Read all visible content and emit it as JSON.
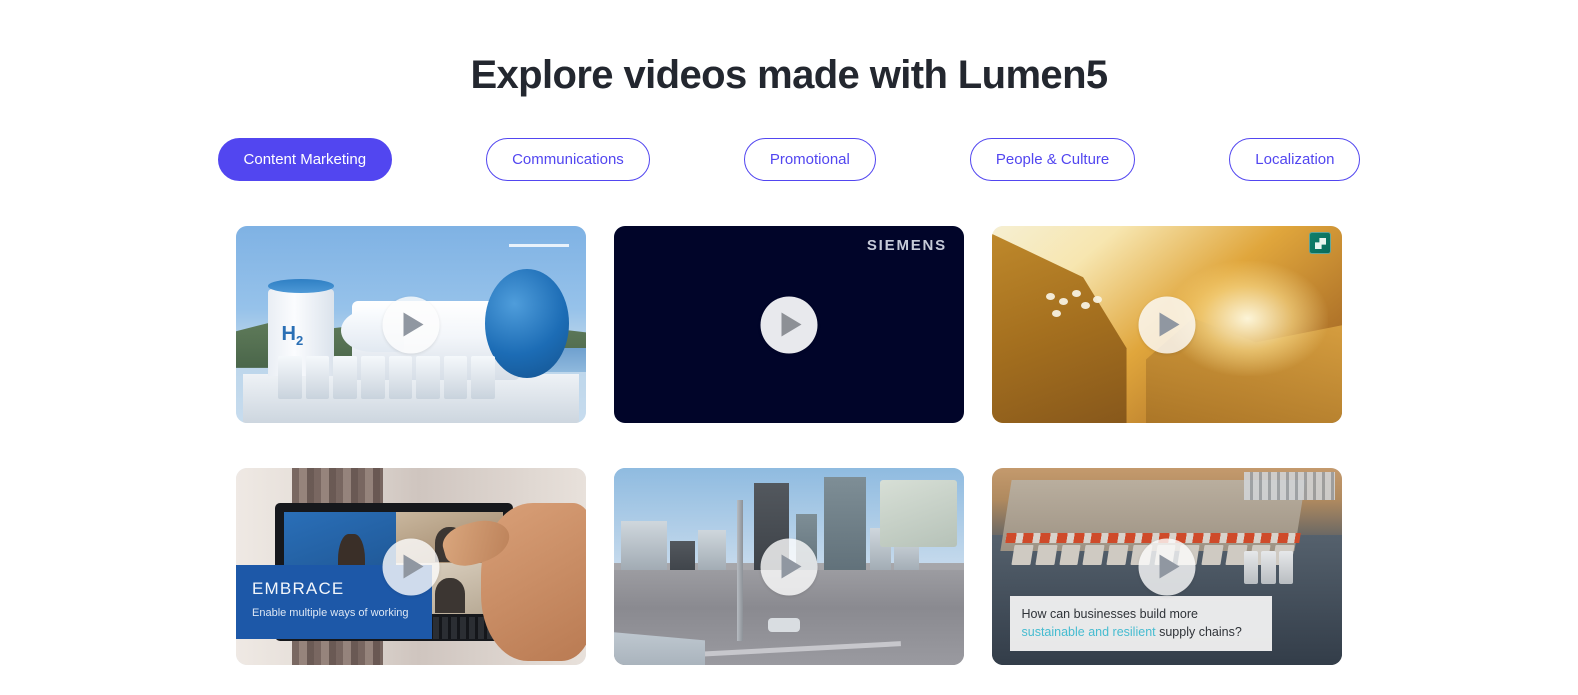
{
  "page": {
    "title": "Explore videos made with Lumen5",
    "background_color": "#ffffff",
    "accent_color": "#5246f0"
  },
  "filters": {
    "items": [
      {
        "label": "Content Marketing",
        "active": true
      },
      {
        "label": "Communications",
        "active": false
      },
      {
        "label": "Promotional",
        "active": false
      },
      {
        "label": "People & Culture",
        "active": false
      },
      {
        "label": "Localization",
        "active": false
      }
    ]
  },
  "videos": [
    {
      "id": "hydrogen-plant",
      "scene": "hydrogen storage plant with H2 tank, white cylinder and blue sphere under blue sky",
      "overlay_label": "H",
      "overlay_sub": "2",
      "play_icon": "play-icon",
      "play_style": "translucent"
    },
    {
      "id": "siemens",
      "scene": "dark navy title card",
      "brand": "SIEMENS",
      "background_color": "#010529",
      "play_icon": "play-icon",
      "play_style": "solid"
    },
    {
      "id": "golden-hillside",
      "scene": "sunlit golden hillside with sheep at sunset",
      "logo_badge": "teal-square-logo",
      "play_icon": "play-icon",
      "play_style": "translucent"
    },
    {
      "id": "embrace-video-call",
      "scene": "laptop video conference call with hand gesturing",
      "banner_title": "EMBRACE",
      "banner_subtitle": "Enable multiple ways of working",
      "banner_color": "#1d58a8",
      "play_icon": "play-icon",
      "play_style": "translucent"
    },
    {
      "id": "city-street",
      "scene": "empty city boulevard with high rise towers and clear sky",
      "play_icon": "play-icon",
      "play_style": "translucent"
    },
    {
      "id": "supply-chain-warehouse",
      "scene": "aerial view of distribution warehouse with trucks at loading docks",
      "caption_part1": "How can businesses build more ",
      "caption_highlight": "sustainable and resilient",
      "caption_part2": " supply chains?",
      "caption_highlight_color": "#46bcd0",
      "play_icon": "play-icon",
      "play_style": "translucent"
    }
  ]
}
